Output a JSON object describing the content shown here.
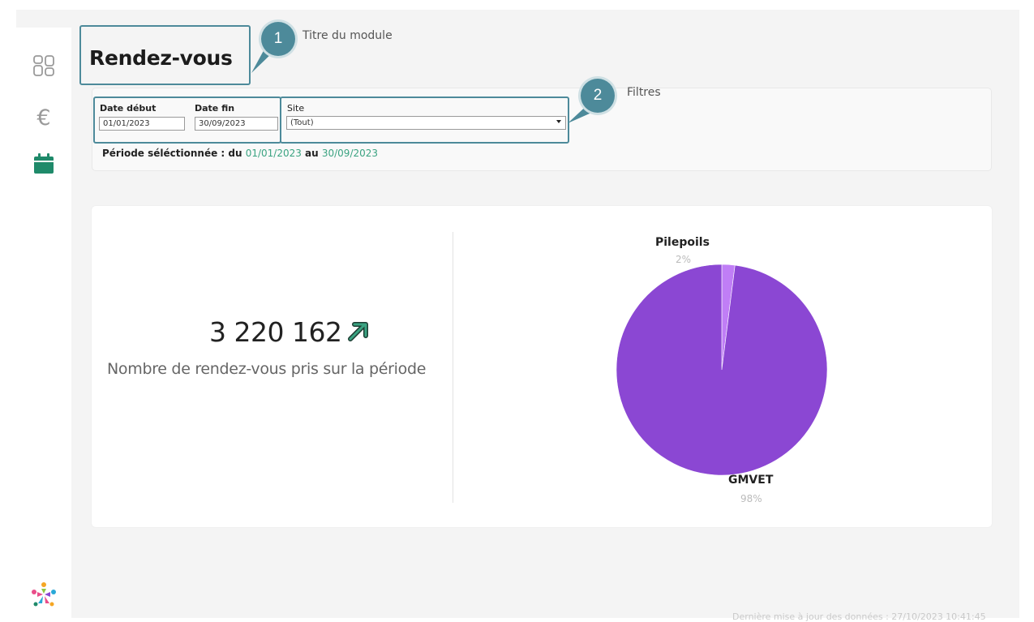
{
  "header": {
    "title": "Rendez-vous"
  },
  "annotations": [
    {
      "number": "1",
      "label": "Titre du module"
    },
    {
      "number": "2",
      "label": "Filtres"
    }
  ],
  "sidebar": {
    "items": [
      {
        "icon": "dashboard-grid-icon",
        "active": false
      },
      {
        "icon": "euro-icon",
        "glyph": "€",
        "active": false
      },
      {
        "icon": "calendar-icon",
        "active": true
      }
    ],
    "logo": "brand-logo-icon"
  },
  "filters": {
    "date_start_label": "Date début",
    "date_start_value": "01/01/2023",
    "date_end_label": "Date fin",
    "date_end_value": "30/09/2023",
    "site_label": "Site",
    "site_value": "(Tout)",
    "period_prefix": "Période séléctionnée : du ",
    "period_from": "01/01/2023",
    "period_middle": " au ",
    "period_to": "30/09/2023"
  },
  "kpi": {
    "value": "3 220 162",
    "trend": "up",
    "label": "Nombre de rendez-vous pris sur la période"
  },
  "chart_data": {
    "type": "pie",
    "slices": [
      {
        "name": "Pilepoils",
        "value": 2,
        "display": "2%",
        "color": "#c07ef6"
      },
      {
        "name": "GMVET",
        "value": 98,
        "display": "98%",
        "color": "#8b47d3"
      }
    ]
  },
  "footer": {
    "note": "Dernière mise à jour des données : 27/10/2023 10:41:45"
  },
  "colors": {
    "accent": "#4d8a9a",
    "positive": "#3aa381",
    "active_icon": "#1f8a6a"
  }
}
